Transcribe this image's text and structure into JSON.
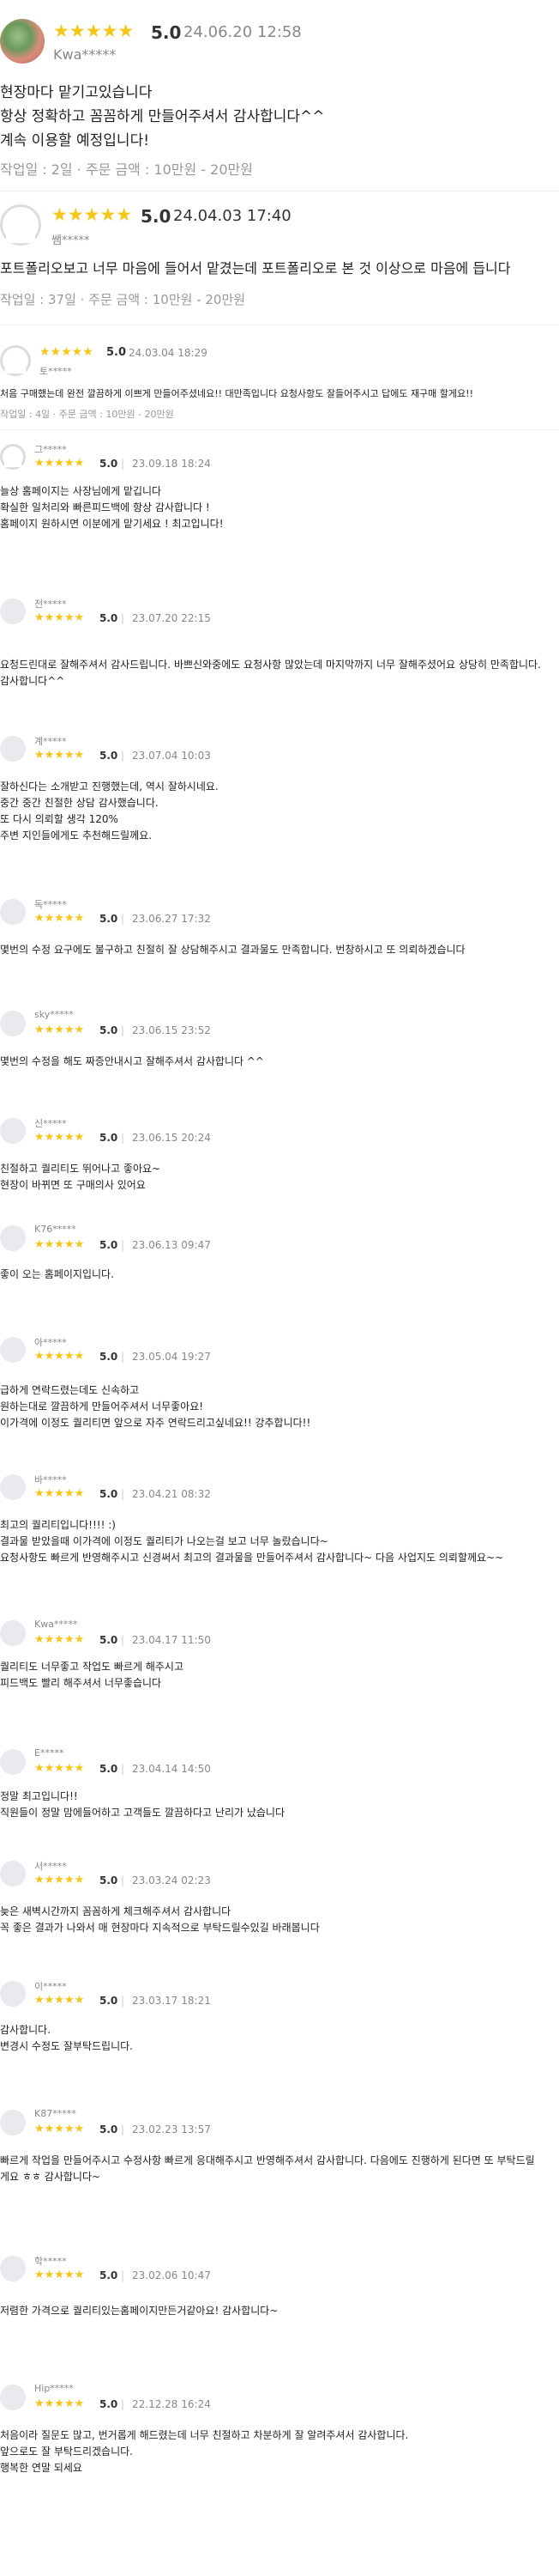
{
  "reviews": [
    {
      "user": "Kwa*****",
      "score": "5.0",
      "date": "24.06.20 12:58",
      "stars": "★★★★★",
      "body": "현장마다 맡기고있습니다\n항상 정확하고 꼼꼼하게 만들어주셔서 감사합니다^^\n계속 이용할 예정입니다!",
      "meta": "작업일 : 2일 · 주문 금액 : 10만원 - 20만원"
    },
    {
      "user": "쌤*****",
      "score": "5.0",
      "date": "24.04.03 17:40",
      "stars": "★★★★★",
      "body": "포트폴리오보고 너무 마음에 들어서 맡겼는데 포트폴리오로 본 것 이상으로 마음에 듭니다",
      "meta": "작업일 : 37일 · 주문 금액 : 10만원 - 20만원"
    },
    {
      "user": "토*****",
      "score": "5.0",
      "date": "24.03.04 18:29",
      "stars": "★★★★★",
      "body": "처음 구매했는데 완전 깔끔하게 이쁘게 만들어주셨네요!! 대만족입니다 요청사항도 잘들어주시고 답에도 재구매 할게요!!",
      "meta": "작업일 : 4일 · 주문 금액 : 10만원 - 20만원"
    },
    {
      "user": "그*****",
      "score": "5.0",
      "date": "23.09.18 18:24",
      "stars": "★★★★★",
      "body": "늘상 홈페이지는 사장님에게 맡깁니다\n확실한 일처리와 빠른피드백에 항상 감사합니다 !\n홈페이지 원하시면 이분에게 맡기세요 ! 최고입니다!"
    },
    {
      "user": "전*****",
      "score": "5.0",
      "date": "23.07.20 22:15",
      "stars": "★★★★★",
      "body": "요청드린대로 잘해주셔서 감사드립니다. 바쁘신와중에도 요청사항 많았는데 마지막까지 너무 잘해주셨어요 상당히 만족합니다. 감사합니다^^"
    },
    {
      "user": "계*****",
      "score": "5.0",
      "date": "23.07.04 10:03",
      "stars": "★★★★★",
      "body": "잘하신다는 소개받고 진행했는데, 역시 잘하시네요.\n중간 중간 친절한 상담 감사했습니다.\n또 다시 의뢰할 생각 120%\n주변 지인들에게도 추천해드릴께요."
    },
    {
      "user": "독*****",
      "score": "5.0",
      "date": "23.06.27 17:32",
      "stars": "★★★★★",
      "body": "몇번의 수정 요구에도 불구하고 친절히 잘 상담해주시고 결과물도 만족합니다. 번창하시고 또 의뢰하겠습니다"
    },
    {
      "user": "sky*****",
      "score": "5.0",
      "date": "23.06.15 23:52",
      "stars": "★★★★★",
      "body": "몇번의 수정을 해도 짜증안내시고 잘해주셔서 감사합니다 ^^"
    },
    {
      "user": "신*****",
      "score": "5.0",
      "date": "23.06.15 20:24",
      "stars": "★★★★★",
      "body": "친절하고 퀄리티도 뛰어나고 좋아요~\n현장이 바뀌면 또 구매의사 있어요"
    },
    {
      "user": "K76*****",
      "score": "5.0",
      "date": "23.06.13 09:47",
      "stars": "★★★★★",
      "body": "좋이 오는 홈페이지입니다."
    },
    {
      "user": "아*****",
      "score": "5.0",
      "date": "23.05.04 19:27",
      "stars": "★★★★★",
      "body": "급하게 연락드렸는데도 신속하고\n원하는대로 깔끔하게 만들어주셔서 너무좋아요!\n이가격에 이정도 퀄리티면 앞으로 자주 연락드리고싶네요!! 강추합니다!!"
    },
    {
      "user": "바*****",
      "score": "5.0",
      "date": "23.04.21 08:32",
      "stars": "★★★★★",
      "body": "최고의 퀄리티입니다!!!! :)\n결과물 받았을때 이가격에 이정도 퀄리티가 나오는걸 보고 너무 놀랐습니다~\n요청사항도 빠르게 반영해주시고 신경써서 최고의 결과물을 만들어주셔서 감사합니다~ 다음 사업지도 의뢰할께요~~"
    },
    {
      "user": "Kwa*****",
      "score": "5.0",
      "date": "23.04.17 11:50",
      "stars": "★★★★★",
      "body": "퀄리티도 너무좋고 작업도 빠르게 해주시고\n피드백도 빨리 해주셔서 너무좋습니다"
    },
    {
      "user": "E*****",
      "score": "5.0",
      "date": "23.04.14 14:50",
      "stars": "★★★★★",
      "body": "정말 최고입니다!!\n직원들이 정말 맘에들어하고 고객들도 깔끔하다고 난리가 났습니다"
    },
    {
      "user": "서*****",
      "score": "5.0",
      "date": "23.03.24 02:23",
      "stars": "★★★★★",
      "body": "늦은 새벽시간까지 꼼꼼하게 체크해주셔서 감사합니다\n꼭 좋은 결과가 나와서 매 현장마다 지속적으로 부탁드릴수있길 바래봅니다"
    },
    {
      "user": "이*****",
      "score": "5.0",
      "date": "23.03.17 18:21",
      "stars": "★★★★★",
      "body": "감사합니다.\n변경시 수정도 잘부탁드립니다."
    },
    {
      "user": "K87*****",
      "score": "5.0",
      "date": "23.02.23 13:57",
      "stars": "★★★★★",
      "body": "빠르게 작업을 만들어주시고 수정사항 빠르게 응대해주시고 반영해주셔서 감사합니다. 다음에도 진행하게 된다면 또 부탁드릴게요 ㅎㅎ 감사합니다~"
    },
    {
      "user": "학*****",
      "score": "5.0",
      "date": "23.02.06 10:47",
      "stars": "★★★★★",
      "body": "저렴한 가격으로 퀄리티있는홈페이지만든거같아요! 감사합니다~"
    },
    {
      "user": "Hip*****",
      "score": "5.0",
      "date": "22.12.28 16:24",
      "stars": "★★★★★",
      "body": "처음이라 질문도 많고, 번거롭게 해드렸는데 너무 친절하고 차분하게 잘 알려주셔서 감사합니다.\n앞으로도 잘 부탁드리겠습니다.\n행복한 연말 되세요"
    }
  ]
}
